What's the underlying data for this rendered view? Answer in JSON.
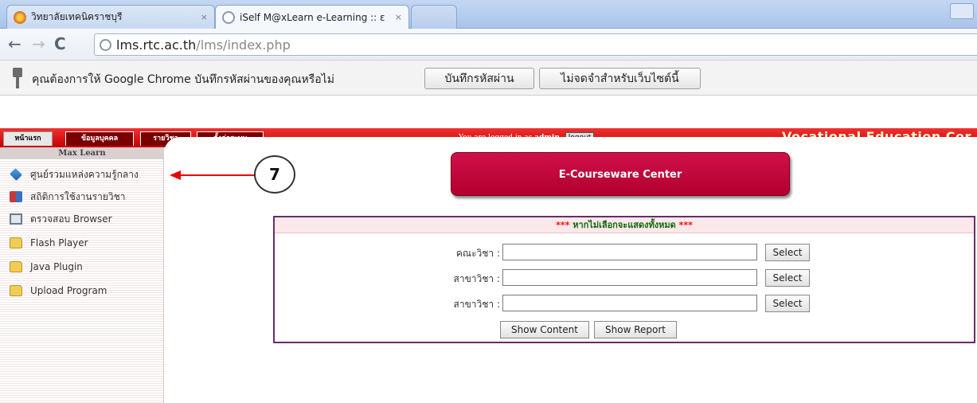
{
  "browser": {
    "tabs": [
      {
        "title": "วิทยาลัยเทคนิคราชบุรี",
        "close": "×"
      },
      {
        "title": "iSelf M@xLearn e-Learning :: ε",
        "close": "×"
      },
      {
        "title": ""
      }
    ],
    "address": {
      "host": "lms.rtc.ac.th",
      "path": "/lms/index.php"
    },
    "nav": {
      "back": "←",
      "forward": "→",
      "reload": "C"
    }
  },
  "infobar": {
    "message": "คุณต้องการให้ Google Chrome บันทึกรหัสผ่านของคุณหรือไม่",
    "save_label": "บันทึกรหัสผ่าน",
    "never_label": "ไม่จดจำสำหรับเว็บไซต์นี้"
  },
  "appnav": {
    "tabs": [
      "หน้าแรก",
      "ข้อมูลบุคคล",
      "รายวิชา",
      "ตั้งค่าระบบ"
    ],
    "login_prefix": "You are logged in as",
    "login_user": "admin",
    "logout_label": "logout",
    "banner_title": "Vocational Education Cor"
  },
  "sidebar": {
    "header": "Max Learn",
    "items": [
      {
        "label": "ศูนย์รวมแหล่งความรู้กลาง",
        "icon": "cube-icon"
      },
      {
        "label": "สถิติการใช้งานรายวิชา",
        "icon": "book-icon"
      },
      {
        "label": "ตรวจสอบ Browser",
        "icon": "computer-icon"
      },
      {
        "label": "Flash Player",
        "icon": "folder-icon"
      },
      {
        "label": "Java Plugin",
        "icon": "folder-icon"
      },
      {
        "label": "Upload Program",
        "icon": "folder-icon"
      }
    ]
  },
  "callout": {
    "number": "7"
  },
  "main": {
    "ecourseware_label": "E-Courseware Center",
    "panel": {
      "stars": "***",
      "title": "หากไม่เลือกจะแสดงทั้งหมด",
      "rows": [
        {
          "label": "คณะวิชา :",
          "value": "",
          "button": "Select"
        },
        {
          "label": "สาขาวิชา :",
          "value": "",
          "button": "Select"
        },
        {
          "label": "สาขาวิชา :",
          "value": "",
          "button": "Select"
        }
      ],
      "show_content_label": "Show Content",
      "show_report_label": "Show Report"
    }
  },
  "colors": {
    "nav_red": "#d80000",
    "accent_crimson": "#c0083c",
    "panel_border": "#6b2a6b"
  }
}
